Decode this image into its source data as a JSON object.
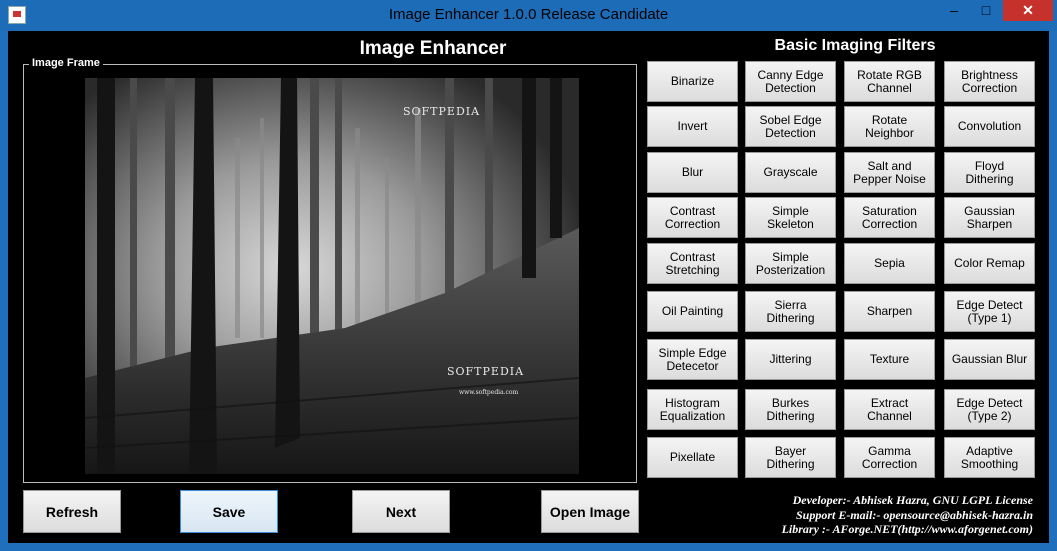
{
  "window": {
    "title": "Image  Enhancer 1.0.0  Release Candidate",
    "minimize": "–",
    "maximize": "□",
    "close": "✕"
  },
  "app": {
    "heading": "Image Enhancer",
    "filters_heading": "Basic Imaging Filters",
    "frame_label": "Image Frame",
    "watermark_top": "SOFTPEDIA",
    "watermark_bottom": "SOFTPEDIA",
    "watermark_url": "www.softpedia.com"
  },
  "filters": [
    [
      "Binarize",
      "Canny Edge\nDetection",
      "Rotate RGB\nChannel",
      "Brightness\nCorrection"
    ],
    [
      "Invert",
      "Sobel Edge\nDetection",
      "Rotate\nNeighbor",
      "Convolution"
    ],
    [
      "Blur",
      "Grayscale",
      "Salt and\nPepper Noise",
      "Floyd\nDithering"
    ],
    [
      "Contrast\nCorrection",
      "Simple\nSkeleton",
      "Saturation\nCorrection",
      "Gaussian\nSharpen"
    ],
    [
      "Contrast\nStretching",
      "Simple\nPosterization",
      "Sepia",
      "Color Remap"
    ],
    [
      "Oil Painting",
      "Sierra\nDithering",
      "Sharpen",
      "Edge Detect\n(Type 1)"
    ],
    [
      "Simple Edge\nDetecetor",
      "Jittering",
      "Texture",
      "Gaussian Blur"
    ],
    [
      "Histogram\nEqualization",
      "Burkes\nDithering",
      "Extract\nChannel",
      "Edge Detect\n(Type 2)"
    ],
    [
      "Pixellate",
      "Bayer\nDithering",
      "Gamma\nCorrection",
      "Adaptive\nSmoothing"
    ]
  ],
  "actions": {
    "refresh": "Refresh",
    "save": "Save",
    "next": "Next",
    "open_image": "Open Image"
  },
  "credits": {
    "developer": "Developer:- Abhisek Hazra, GNU LGPL License",
    "email": "Support E-mail:- opensource@abhisek-hazra.in",
    "library": "Library :- AForge.NET(http://www.aforgenet.com)"
  }
}
